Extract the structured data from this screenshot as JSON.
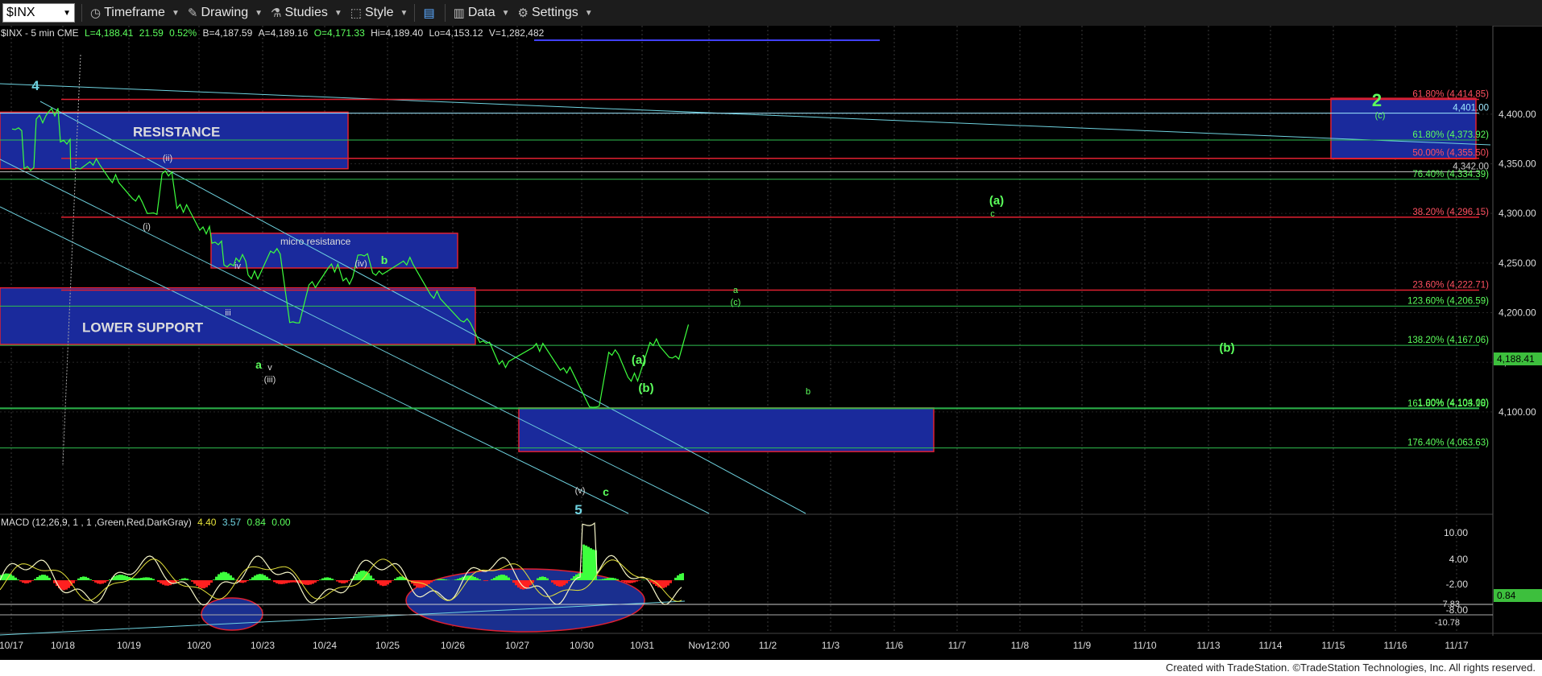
{
  "toolbar": {
    "symbol": "$INX",
    "timeframe": "Timeframe",
    "drawing": "Drawing",
    "studies": "Studies",
    "style": "Style",
    "data": "Data",
    "settings": "Settings"
  },
  "header_info": "$INX - 5 min  CME",
  "quote": {
    "last": "L=4,188.41",
    "change": "21.59",
    "pct": "0.52%",
    "bid": "B=4,187.59",
    "ask": "A=4,189.16",
    "open": "O=4,171.33",
    "high": "Hi=4,189.40",
    "low": "Lo=4,153.12",
    "volume": "V=1,282,482"
  },
  "chart_data": [
    {
      "type": "line",
      "title": "$INX - 5 min",
      "x_tick_labels": [
        "10/17",
        "10/18",
        "10/19",
        "10/20",
        "10/23",
        "10/24",
        "10/25",
        "10/26",
        "10/27",
        "10/30",
        "10/31",
        "Nov12:00",
        "11/2",
        "11/3",
        "11/6",
        "11/7",
        "11/8",
        "11/9",
        "11/10",
        "11/13",
        "11/14",
        "11/15",
        "11/16",
        "11/17"
      ],
      "y_tick_labels": [
        "4,400.00",
        "4,350.00",
        "4,300.00",
        "4,250.00",
        "4,200.00",
        "4,150.00",
        "4,100.00"
      ],
      "ylim": [
        4054,
        4470
      ],
      "last_price": "4,188.41",
      "price_path": [
        {
          "x": "10/17",
          "y": 4385
        },
        {
          "x": "10/17",
          "y": 4345
        },
        {
          "x": "10/17",
          "y": 4395
        },
        {
          "x": "10/17",
          "y": 4402
        },
        {
          "x": "10/17",
          "y": 4372
        },
        {
          "x": "10/18",
          "y": 4345
        },
        {
          "x": "10/18",
          "y": 4352
        },
        {
          "x": "10/18",
          "y": 4335
        },
        {
          "x": "10/19",
          "y": 4315
        },
        {
          "x": "10/19",
          "y": 4300
        },
        {
          "x": "10/19",
          "y": 4340
        },
        {
          "x": "10/19",
          "y": 4305
        },
        {
          "x": "10/20",
          "y": 4283
        },
        {
          "x": "10/20",
          "y": 4270
        },
        {
          "x": "10/20",
          "y": 4248
        },
        {
          "x": "10/20",
          "y": 4255
        },
        {
          "x": "10/20",
          "y": 4238
        },
        {
          "x": "10/23",
          "y": 4262
        },
        {
          "x": "10/23",
          "y": 4190
        },
        {
          "x": "10/23",
          "y": 4228
        },
        {
          "x": "10/24",
          "y": 4245
        },
        {
          "x": "10/24",
          "y": 4232
        },
        {
          "x": "10/24",
          "y": 4258
        },
        {
          "x": "10/24",
          "y": 4240
        },
        {
          "x": "10/25",
          "y": 4252
        },
        {
          "x": "10/25",
          "y": 4218
        },
        {
          "x": "10/26",
          "y": 4192
        },
        {
          "x": "10/26",
          "y": 4170
        },
        {
          "x": "10/26",
          "y": 4148
        },
        {
          "x": "10/27",
          "y": 4165
        },
        {
          "x": "10/27",
          "y": 4142
        },
        {
          "x": "10/30",
          "y": 4105
        },
        {
          "x": "10/30",
          "y": 4160
        },
        {
          "x": "10/30",
          "y": 4135
        },
        {
          "x": "10/31",
          "y": 4170
        },
        {
          "x": "10/31",
          "y": 4155
        },
        {
          "x": "10/31",
          "y": 4188
        }
      ],
      "fib_levels": [
        {
          "label": "61.80% (4,414.85)",
          "value": 4414.85,
          "color": "#e02030"
        },
        {
          "label": "4,401.00",
          "value": 4401.0,
          "color": "#9fe8ff"
        },
        {
          "label": "61.80% (4,373.92)",
          "value": 4373.92,
          "color": "#2fbf4f"
        },
        {
          "label": "50.00% (4,355.50)",
          "value": 4355.5,
          "color": "#e02030"
        },
        {
          "label": "4,342.00",
          "value": 4342.0,
          "color": "#cccccc"
        },
        {
          "label": "76.40% (4,334.39)",
          "value": 4334.39,
          "color": "#2fbf4f"
        },
        {
          "label": "38.20% (4,296.15)",
          "value": 4296.15,
          "color": "#e02030"
        },
        {
          "label": "23.60% (4,222.71)",
          "value": 4222.71,
          "color": "#e02030"
        },
        {
          "label": "123.60% (4,206.59)",
          "value": 4206.59,
          "color": "#2fbf4f"
        },
        {
          "label": "138.20% (4,167.06)",
          "value": 4167.06,
          "color": "#2fbf4f"
        },
        {
          "label": "161.80% (4,103.18)",
          "value": 4103.18,
          "color": "#2fbf4f"
        },
        {
          "label": "1.00% (4,104.00)",
          "value": 4104.0,
          "color": "#2fbf4f"
        },
        {
          "label": "176.40% (4,063.63)",
          "value": 4063.63,
          "color": "#2fbf4f"
        }
      ],
      "zones": [
        {
          "label": "RESISTANCE",
          "x_from": "10/17",
          "x_to": "10/24",
          "y_from": 4345,
          "y_to": 4402
        },
        {
          "label": "micro resistance",
          "x_from": "10/20",
          "x_to": "10/26",
          "y_from": 4245,
          "y_to": 4280
        },
        {
          "label": "LOWER SUPPORT",
          "x_from": "10/17",
          "x_to": "10/26",
          "y_from": 4168,
          "y_to": 4225
        },
        {
          "label": "",
          "x_from": "10/27",
          "x_to": "11/6",
          "y_from": 4060,
          "y_to": 4104
        },
        {
          "label": "",
          "x_from": "11/15",
          "x_to": "11/17",
          "y_from": 4355,
          "y_to": 4416
        }
      ],
      "wave_labels": {
        "white": [
          "(ii)",
          "(i)",
          "iv",
          "iii",
          "(iv)",
          "v",
          "(iii)",
          "(v)"
        ],
        "green": [
          "b",
          "a",
          "c",
          "(a)",
          "c",
          "a",
          "(c)",
          "(a)",
          "(b)",
          "(b)",
          "b",
          "2",
          "(c)"
        ],
        "cyan": [
          "4",
          "5"
        ]
      }
    },
    {
      "type": "line",
      "title": "MACD (12,26,9, 1 , 1 ,Green,Red,DarkGray)",
      "values": [
        "4.40",
        "3.57",
        "0.84",
        "0.00"
      ],
      "y_tick_labels": [
        "10.00",
        "4.00",
        "-2.00",
        "-8.00"
      ],
      "extra_labels": [
        "-7.83",
        "-10.78"
      ],
      "current_hist": "0.84"
    }
  ],
  "footer": "Created with TradeStation. ©TradeStation Technologies, Inc. All rights reserved."
}
